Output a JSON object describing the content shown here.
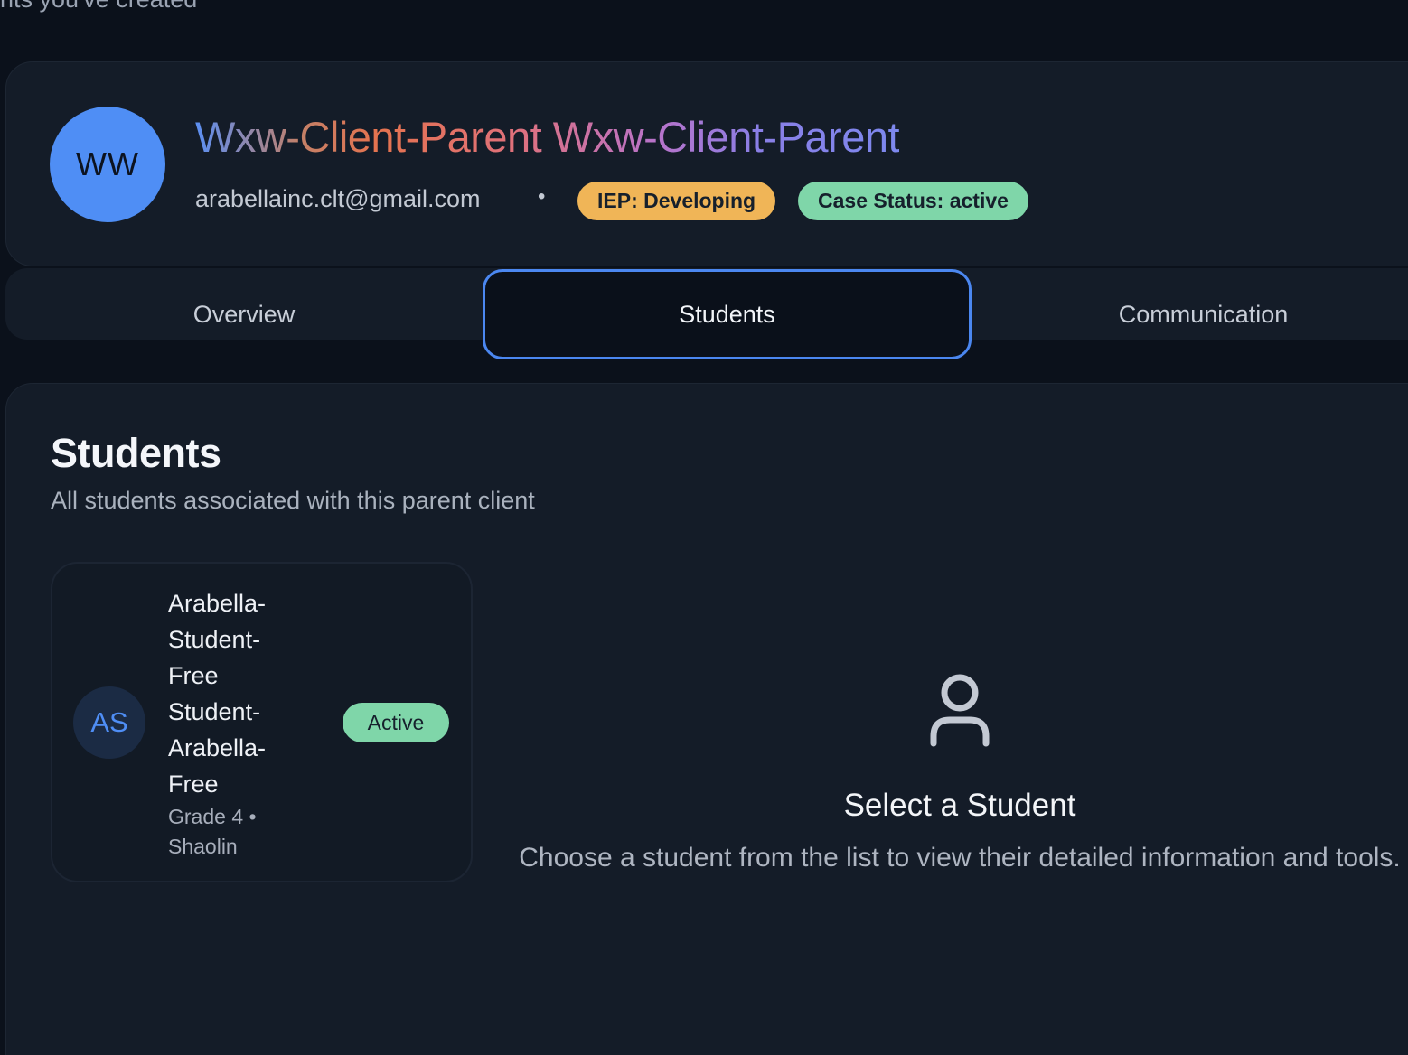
{
  "page_top": {
    "cut_text": "nts you've created"
  },
  "client": {
    "initials": "WW",
    "name": "Wxw-Client-Parent Wxw-Client-Parent",
    "email": "arabellainc.clt@gmail.com",
    "separator": "•",
    "iep_badge": "IEP: Developing",
    "case_badge": "Case Status: active"
  },
  "tabs": [
    {
      "label": "Overview",
      "active": false
    },
    {
      "label": "Students",
      "active": true
    },
    {
      "label": "Communication",
      "active": false
    }
  ],
  "students_section": {
    "title": "Students",
    "subtitle": "All students associated with this parent client",
    "students": [
      {
        "initials": "AS",
        "name": "Arabella-Student-Free Student-Arabella-Free",
        "meta": "Grade 4 • Shaolin",
        "status": "Active"
      }
    ],
    "empty_state": {
      "icon": "user-icon",
      "title": "Select a Student",
      "text": "Choose a student from the list to view their detailed information and tools."
    }
  },
  "colors": {
    "background": "#0b111b",
    "card": "#141c28",
    "accent": "#4f8ef5",
    "iep_badge": "#f0b557",
    "status_green": "#7fd6a9"
  }
}
